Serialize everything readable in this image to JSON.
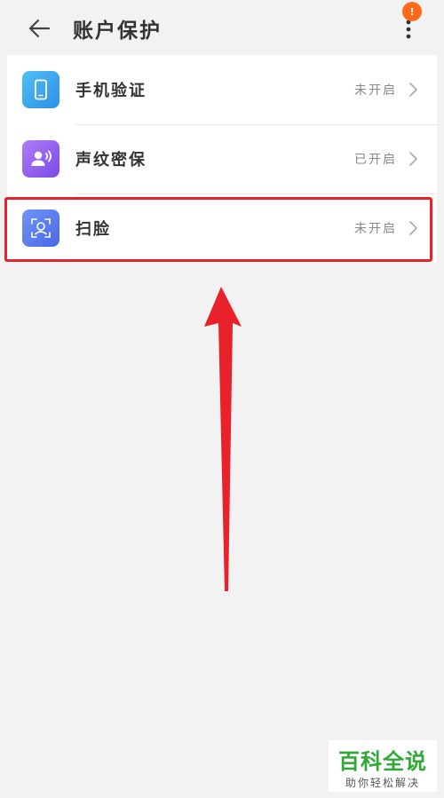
{
  "header": {
    "title": "账户保护",
    "badge": "!"
  },
  "items": [
    {
      "label": "手机验证",
      "status": "未开启",
      "icon": "phone-icon",
      "color": "#3ea6f0"
    },
    {
      "label": "声纹密保",
      "status": "已开启",
      "icon": "voiceprint-icon",
      "color": "#8a5cf0"
    },
    {
      "label": "扫脸",
      "status": "未开启",
      "icon": "face-scan-icon",
      "color": "#5b7cf0"
    }
  ],
  "colors": {
    "highlight": "#e8212b",
    "badge": "#ff6a1a",
    "watermark_green": "#2fa835"
  },
  "watermark": {
    "main": "百科全说",
    "sub": "助你轻松解决"
  }
}
